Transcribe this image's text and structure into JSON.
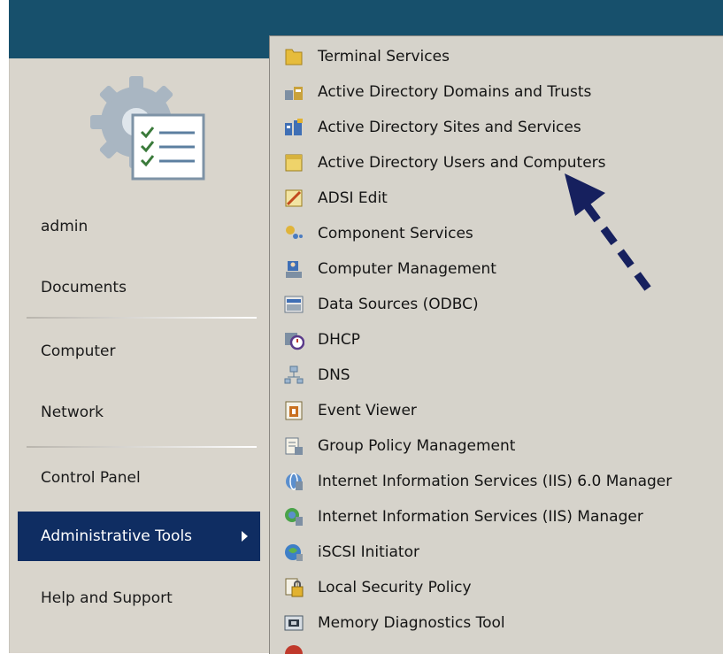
{
  "left_menu": {
    "items": [
      {
        "label": "admin"
      },
      {
        "label": "Documents"
      },
      {
        "label": "Computer"
      },
      {
        "label": "Network"
      },
      {
        "label": "Control Panel"
      },
      {
        "label": "Administrative Tools"
      },
      {
        "label": "Help and Support"
      }
    ],
    "selected_label": "Administrative Tools"
  },
  "submenu": {
    "items": [
      {
        "label": "Terminal Services",
        "icon": "folder-icon"
      },
      {
        "label": "Active Directory Domains and Trusts",
        "icon": "domains-trusts-icon"
      },
      {
        "label": "Active Directory Sites and Services",
        "icon": "sites-services-icon"
      },
      {
        "label": "Active Directory Users and Computers",
        "icon": "users-computers-icon"
      },
      {
        "label": "ADSI Edit",
        "icon": "adsi-edit-icon"
      },
      {
        "label": "Component Services",
        "icon": "component-services-icon"
      },
      {
        "label": "Computer Management",
        "icon": "computer-management-icon"
      },
      {
        "label": "Data Sources (ODBC)",
        "icon": "odbc-icon"
      },
      {
        "label": "DHCP",
        "icon": "dhcp-icon"
      },
      {
        "label": "DNS",
        "icon": "dns-icon"
      },
      {
        "label": "Event Viewer",
        "icon": "event-viewer-icon"
      },
      {
        "label": "Group Policy Management",
        "icon": "group-policy-icon"
      },
      {
        "label": "Internet Information Services (IIS) 6.0 Manager",
        "icon": "iis6-icon"
      },
      {
        "label": "Internet Information Services (IIS) Manager",
        "icon": "iis-icon"
      },
      {
        "label": "iSCSI Initiator",
        "icon": "iscsi-icon"
      },
      {
        "label": "Local Security Policy",
        "icon": "security-policy-icon"
      },
      {
        "label": "Memory Diagnostics Tool",
        "icon": "memory-diagnostics-icon"
      }
    ]
  },
  "colors": {
    "taskbar": "#17506c",
    "selection": "#0f2d62",
    "menu_bg": "#d6d3cb",
    "annotation_arrow": "#16205e"
  }
}
